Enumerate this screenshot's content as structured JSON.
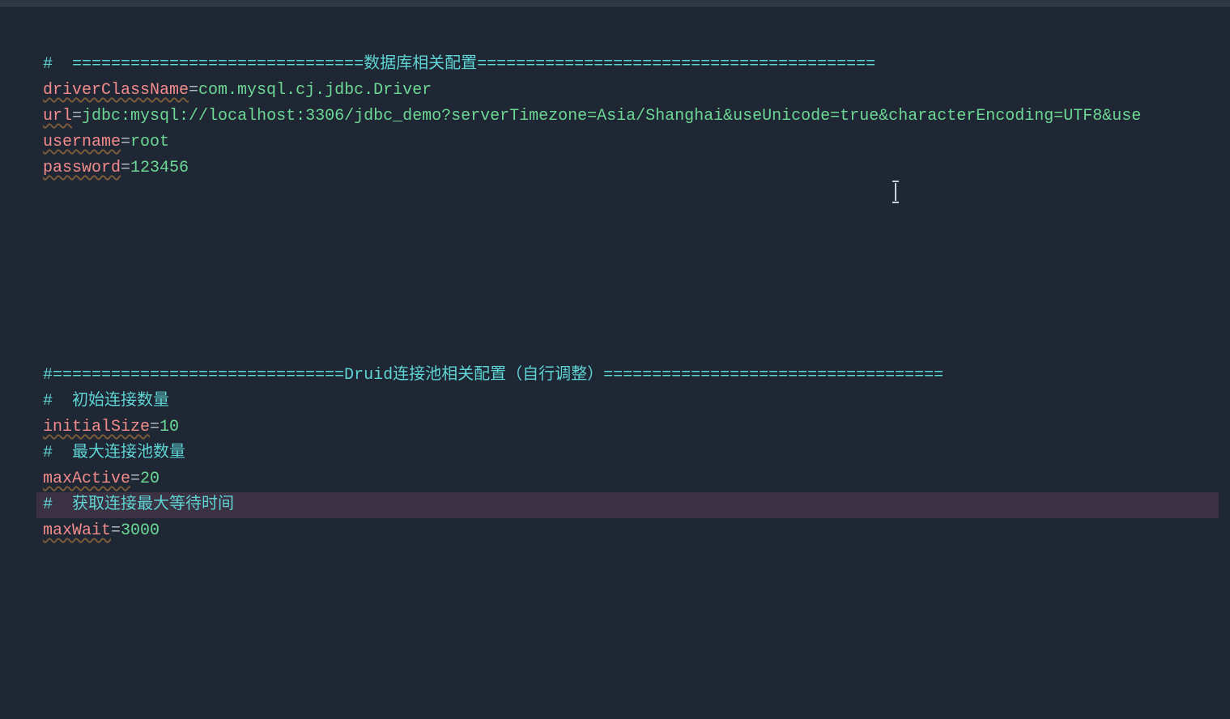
{
  "lines": [
    {
      "type": "comment",
      "text": "#  ==============================数据库相关配置========================================="
    },
    {
      "type": "kv",
      "key": "driverClassName",
      "value": "com.mysql.cj.jdbc.Driver"
    },
    {
      "type": "kv",
      "key": "url",
      "value": "jdbc:mysql://localhost:3306/jdbc_demo?serverTimezone=Asia/Shanghai&useUnicode=true&characterEncoding=UTF8&use"
    },
    {
      "type": "kv",
      "key": "username",
      "value": "root"
    },
    {
      "type": "kv",
      "key": "password",
      "value": "123456"
    },
    {
      "type": "empty"
    },
    {
      "type": "empty"
    },
    {
      "type": "empty"
    },
    {
      "type": "empty"
    },
    {
      "type": "empty"
    },
    {
      "type": "empty"
    },
    {
      "type": "empty"
    },
    {
      "type": "comment",
      "text": "#==============================Druid连接池相关配置（自行调整）==================================="
    },
    {
      "type": "comment",
      "text": "#  初始连接数量"
    },
    {
      "type": "kv",
      "key": "initialSize",
      "value": "10"
    },
    {
      "type": "comment",
      "text": "#  最大连接池数量"
    },
    {
      "type": "kv",
      "key": "maxActive",
      "value": "20"
    },
    {
      "type": "comment",
      "text": "#  获取连接最大等待时间",
      "highlighted": true
    },
    {
      "type": "kv",
      "key": "maxWait",
      "value": "3000"
    }
  ],
  "equals_sign": "="
}
